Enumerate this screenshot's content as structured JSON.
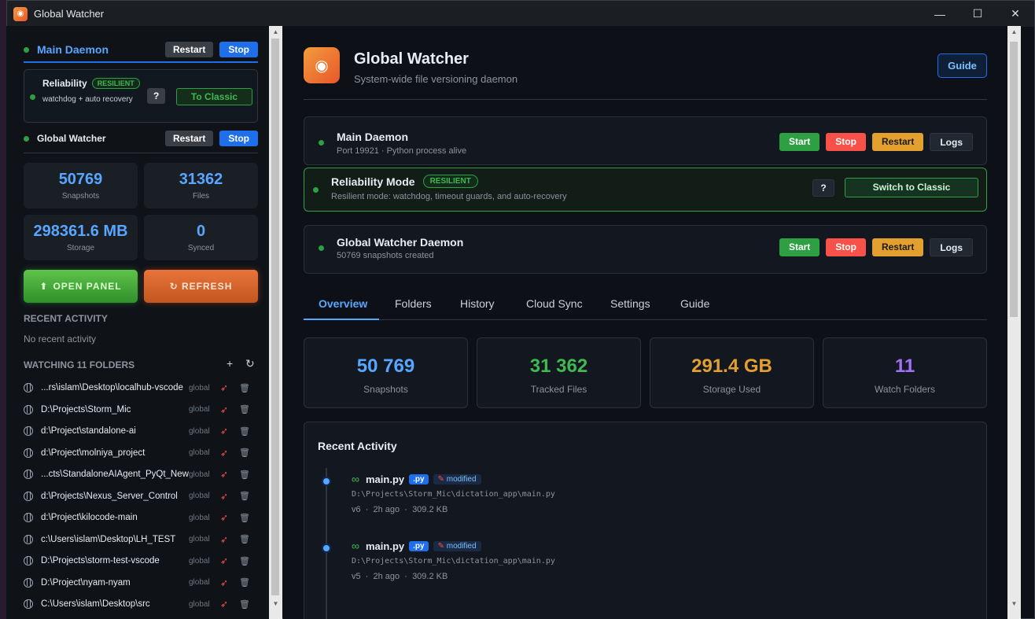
{
  "window": {
    "title": "Global Watcher",
    "minimize": "—",
    "maximize": "☐",
    "close": "✕"
  },
  "sidebar": {
    "main_daemon": {
      "name": "Main Daemon",
      "restart": "Restart",
      "stop": "Stop"
    },
    "reliability": {
      "label": "Reliability",
      "badge": "RESILIENT",
      "desc": "watchdog + auto recovery",
      "help": "?",
      "switch": "To Classic"
    },
    "global_watcher": {
      "name": "Global Watcher",
      "restart": "Restart",
      "stop": "Stop"
    },
    "stats": [
      {
        "value": "50769",
        "label": "Snapshots"
      },
      {
        "value": "31362",
        "label": "Files"
      },
      {
        "value": "298361.6 MB",
        "label": "Storage"
      },
      {
        "value": "0",
        "label": "Synced"
      }
    ],
    "open_panel": "OPEN PANEL",
    "refresh": "↻ REFRESH",
    "recent_activity_title": "RECENT ACTIVITY",
    "no_recent": "No recent activity",
    "watching_title": "WATCHING 11 FOLDERS",
    "add": "+",
    "reload": "↻",
    "folders": [
      {
        "path": "...rs\\islam\\Desktop\\localhub-vscode",
        "scope": "global"
      },
      {
        "path": "D:\\Projects\\Storm_Mic",
        "scope": "global"
      },
      {
        "path": "d:\\Project\\standalone-ai",
        "scope": "global"
      },
      {
        "path": "d:\\Project\\molniya_project",
        "scope": "global"
      },
      {
        "path": "...cts\\StandaloneAIAgent_PyQt_New",
        "scope": "global"
      },
      {
        "path": "d:\\Projects\\Nexus_Server_Control",
        "scope": "global"
      },
      {
        "path": "d:\\Project\\kilocode-main",
        "scope": "global"
      },
      {
        "path": "c:\\Users\\islam\\Desktop\\LH_TEST",
        "scope": "global"
      },
      {
        "path": "D:\\Projects\\storm-test-vscode",
        "scope": "global"
      },
      {
        "path": "D:\\Project\\nyam-nyam",
        "scope": "global"
      },
      {
        "path": "C:\\Users\\islam\\Desktop\\src",
        "scope": "global"
      }
    ]
  },
  "header": {
    "title": "Global Watcher",
    "subtitle": "System-wide file versioning daemon",
    "guide": "Guide"
  },
  "daemons": {
    "main": {
      "name": "Main Daemon",
      "status": "Port 19921 · Python process alive"
    },
    "reliability": {
      "name": "Reliability Mode",
      "badge": "RESILIENT",
      "desc": "Resilient mode: watchdog, timeout guards, and auto-recovery",
      "help": "?",
      "switch": "Switch to Classic"
    },
    "global": {
      "name": "Global Watcher Daemon",
      "status": "50769 snapshots created"
    },
    "buttons": {
      "start": "Start",
      "stop": "Stop",
      "restart": "Restart",
      "logs": "Logs"
    }
  },
  "tabs": [
    "Overview",
    "Folders",
    "History",
    "Cloud Sync",
    "Settings",
    "Guide"
  ],
  "overview_stats": [
    {
      "value": "50 769",
      "label": "Snapshots",
      "color": "#58a6ff"
    },
    {
      "value": "31 362",
      "label": "Tracked Files",
      "color": "#3fb950"
    },
    {
      "value": "291.4 GB",
      "label": "Storage Used",
      "color": "#e3a02f"
    },
    {
      "value": "11",
      "label": "Watch Folders",
      "color": "#a371f7"
    }
  ],
  "recent_activity": {
    "title": "Recent Activity",
    "items": [
      {
        "file": "main.py",
        "ext": ".py",
        "status": "modified",
        "path": "D:\\Projects\\Storm_Mic\\dictation_app\\main.py",
        "version": "v6",
        "time": "2h ago",
        "size": "309.2 KB"
      },
      {
        "file": "main.py",
        "ext": ".py",
        "status": "modified",
        "path": "D:\\Projects\\Storm_Mic\\dictation_app\\main.py",
        "version": "v5",
        "time": "2h ago",
        "size": "309.2 KB"
      }
    ]
  },
  "colors": {
    "accent": "#1f6feb",
    "success": "#2ea043",
    "danger": "#f85149",
    "warning": "#e3a02f"
  }
}
